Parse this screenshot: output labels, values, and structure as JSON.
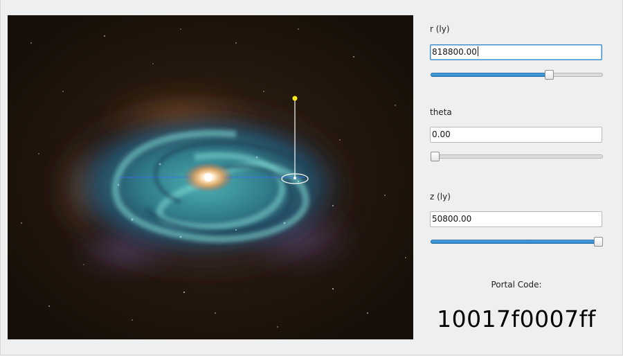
{
  "controls": {
    "r": {
      "label": "r (ly)",
      "value": "818800.00",
      "slider_fraction": 0.7
    },
    "theta": {
      "label": "theta",
      "value": "0.00",
      "slider_fraction": 0.0
    },
    "z": {
      "label": "z (ly)",
      "value": "50800.00",
      "slider_fraction": 1.0
    }
  },
  "portal": {
    "caption": "Portal Code:",
    "code": "10017f0007ff"
  },
  "colors": {
    "slider_fill": "#3a95d5",
    "focus_border": "#3b8fd1",
    "marker_yellow": "#ffe81a",
    "space_background": "#1d130c"
  },
  "icons": {
    "position_marker": "yellow-pin-icon",
    "ground_ring": "ellipse-ring-icon"
  }
}
